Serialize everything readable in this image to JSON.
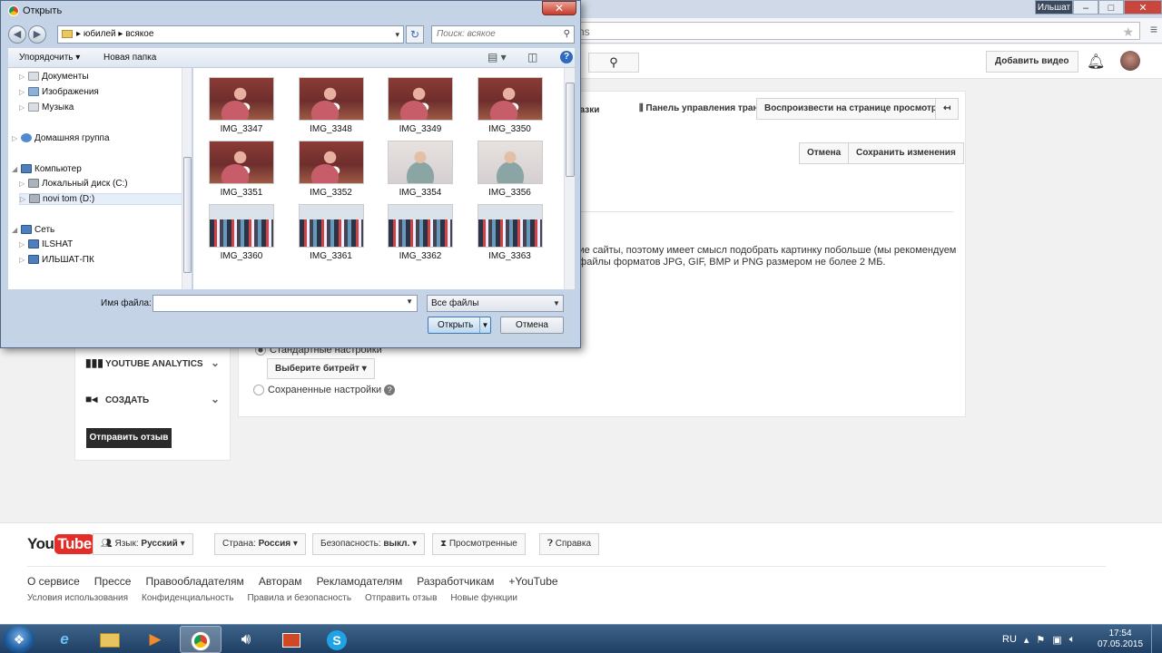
{
  "browser": {
    "omnibox_fragment": "ns",
    "user_badge": "Ильшат"
  },
  "youtube": {
    "add_video": "Добавить видео",
    "tools": {
      "hint": "сказки",
      "dashboard": "Панель управления тран"
    },
    "play_on_watch": "Воспроизвести на странице просмотра",
    "cancel": "Отмена",
    "save_changes": "Сохранить изменения",
    "description": "угие сайты, поэтому имеет смысл подобрать картинку побольше (мы рекомендуем е файлы форматов JPG, GIF, BMP и PNG размером не более 2 МБ.",
    "standard_settings": "Стандартные настройки",
    "select_bitrate": "Выберите битрейт",
    "saved_settings": "Сохраненные настройки",
    "sidebar": [
      {
        "label": "YOUTUBE ANALYTICS",
        "icon": "bar-chart-icon"
      },
      {
        "label": "СОЗДАТЬ",
        "icon": "video-camera-icon"
      }
    ],
    "feedback": "Отправить отзыв"
  },
  "footer": {
    "logo": {
      "you": "You",
      "tube": "Tube"
    },
    "language_label": "Язык:",
    "language_value": "Русский",
    "country_label": "Страна:",
    "country_value": "Россия",
    "safety_label": "Безопасность:",
    "safety_value": "выкл.",
    "history": "Просмотренные",
    "help": "Справка",
    "links": [
      "О сервисе",
      "Прессе",
      "Правообладателям",
      "Авторам",
      "Рекламодателям",
      "Разработчикам",
      "+YouTube"
    ],
    "links2": [
      "Условия использования",
      "Конфиденциальность",
      "Правила и безопасность",
      "Отправить отзыв",
      "Новые функции"
    ]
  },
  "taskbar": {
    "lang": "RU",
    "time": "17:54",
    "date": "07.05.2015"
  },
  "dialog": {
    "title": "Открыть",
    "path": [
      "юбилей",
      "всякое"
    ],
    "search_placeholder": "Поиск: всякое",
    "organize": "Упорядочить",
    "new_folder": "Новая папка",
    "tree": [
      {
        "label": "Документы",
        "level": 1,
        "color": "#d9dde4"
      },
      {
        "label": "Изображения",
        "level": 1,
        "color": "#8fb0d6"
      },
      {
        "label": "Музыка",
        "level": 1,
        "color": "#d9dde4"
      },
      {
        "label": "Домашняя группа",
        "level": 0,
        "color": "#4f8bd1"
      },
      {
        "label": "Компьютер",
        "level": 0,
        "color": "#4d7fbf"
      },
      {
        "label": "Локальный диск (C:)",
        "level": 1,
        "color": "#a9b2bd"
      },
      {
        "label": "novi tom (D:)",
        "level": 1,
        "color": "#a9b2bd"
      },
      {
        "label": "Сеть",
        "level": 0,
        "color": "#4d7fbf"
      },
      {
        "label": "ILSHAT",
        "level": 1,
        "color": "#4d7fbf"
      },
      {
        "label": "ИЛЬШАТ-ПК",
        "level": 1,
        "color": "#4d7fbf"
      }
    ],
    "files": [
      {
        "name": "IMG_3347",
        "kind": "woman"
      },
      {
        "name": "IMG_3348",
        "kind": "woman"
      },
      {
        "name": "IMG_3349",
        "kind": "woman"
      },
      {
        "name": "IMG_3350",
        "kind": "woman"
      },
      {
        "name": "IMG_3351",
        "kind": "woman"
      },
      {
        "name": "IMG_3352",
        "kind": "woman"
      },
      {
        "name": "IMG_3354",
        "kind": "boy"
      },
      {
        "name": "IMG_3356",
        "kind": "boy"
      },
      {
        "name": "IMG_3360",
        "kind": "crowd"
      },
      {
        "name": "IMG_3361",
        "kind": "crowd"
      },
      {
        "name": "IMG_3362",
        "kind": "crowd"
      },
      {
        "name": "IMG_3363",
        "kind": "crowd"
      }
    ],
    "filename_label": "Имя файла:",
    "filename_value": "",
    "filetype": "Все файлы",
    "open": "Открыть",
    "cancel": "Отмена"
  }
}
